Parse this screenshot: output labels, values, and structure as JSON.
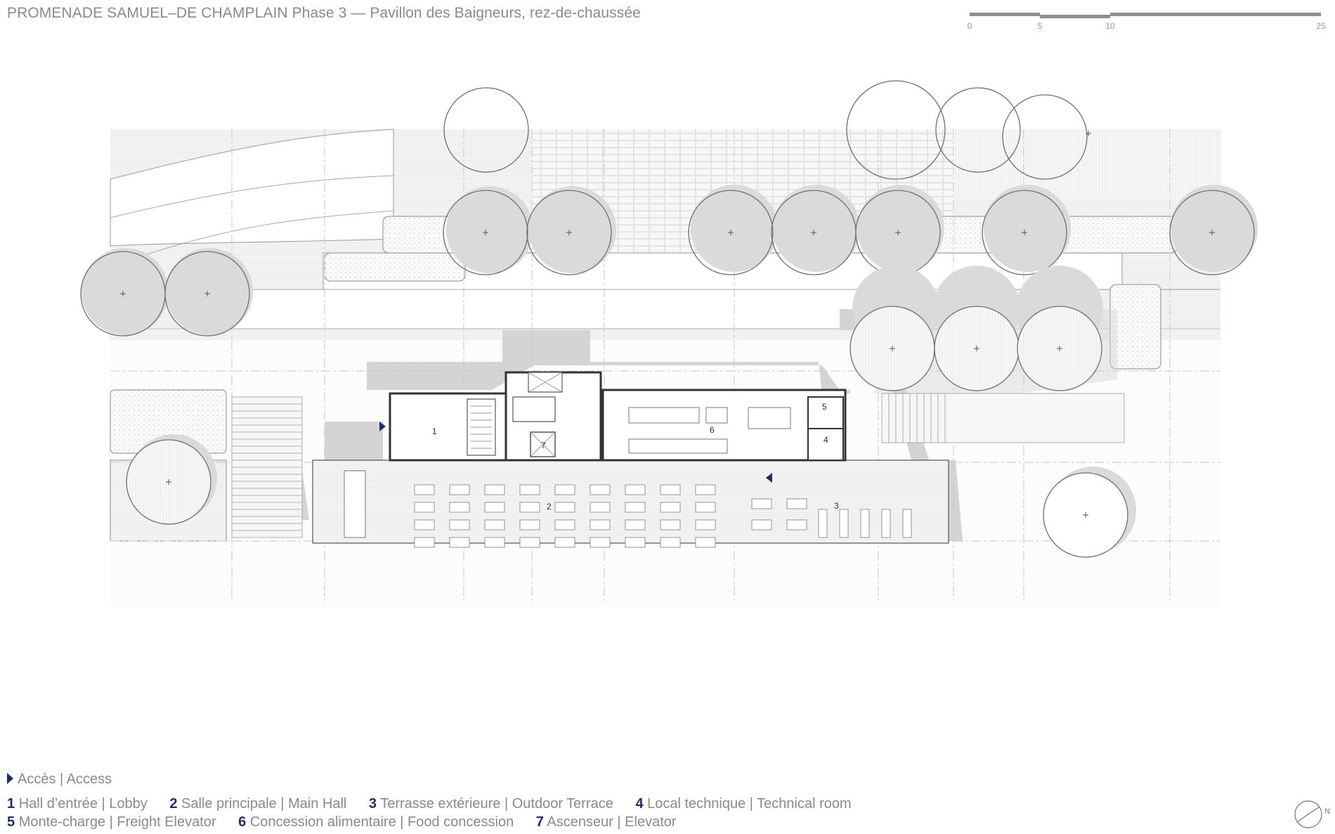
{
  "title": "PROMENADE SAMUEL–DE CHAMPLAIN Phase 3 — Pavillon des Baigneurs, rez-de-chaussée",
  "scale": {
    "ticks": [
      "0",
      "5",
      "10",
      "25"
    ]
  },
  "plan_labels": {
    "room1": "1",
    "room2": "2",
    "room3": "3",
    "room4": "4",
    "room5": "5",
    "room6": "6",
    "room7": "7"
  },
  "legend": {
    "access": "Accès | Access",
    "rooms": [
      {
        "num": "1",
        "label": "Hall d’entrée | Lobby"
      },
      {
        "num": "2",
        "label": "Salle principale | Main Hall"
      },
      {
        "num": "3",
        "label": "Terrasse extérieure | Outdoor Terrace"
      },
      {
        "num": "4",
        "label": "Local technique | Technical room"
      },
      {
        "num": "5",
        "label": "Monte-charge | Freight Elevator"
      },
      {
        "num": "6",
        "label": "Concession alimentaire | Food concession"
      },
      {
        "num": "7",
        "label": "Ascenseur | Elevator"
      }
    ]
  },
  "north_label": "N",
  "colors": {
    "accent": "#1e2d6b",
    "line": "#555555",
    "shade": "#d7d7d7"
  }
}
